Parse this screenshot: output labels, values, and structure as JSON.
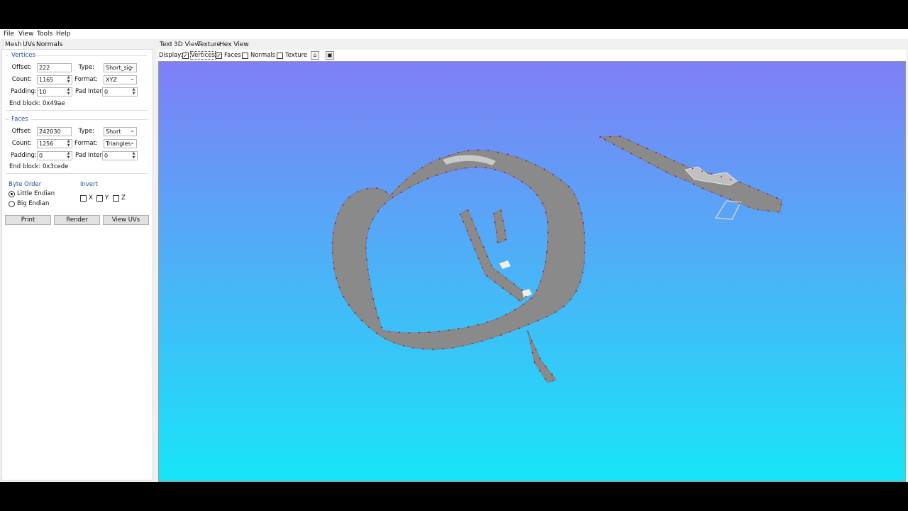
{
  "menu": [
    "File",
    "View",
    "Tools",
    "Help"
  ],
  "left_tabs": [
    "Mesh",
    "UVs",
    "Normals"
  ],
  "vertices": {
    "title": "Vertices",
    "offset_label": "Offset:",
    "offset": "222",
    "type_label": "Type:",
    "type": "Short_sig",
    "count_label": "Count:",
    "count": "1165",
    "format_label": "Format:",
    "format": "XYZ",
    "padding_label": "Padding:",
    "padding": "10",
    "pad_inter_label": "Pad Inter:",
    "pad_inter": "0",
    "end_block": "End block: 0x49ae"
  },
  "faces": {
    "title": "Faces",
    "offset_label": "Offset:",
    "offset": "242030",
    "type_label": "Type:",
    "type": "Short",
    "count_label": "Count:",
    "count": "1256",
    "format_label": "Format:",
    "format": "Triangles",
    "padding_label": "Padding:",
    "padding": "0",
    "pad_inter_label": "Pad Inter:",
    "pad_inter": "0",
    "end_block": "End block: 0x3cede"
  },
  "byte_order": {
    "title": "Byte Order",
    "little": "Little Endian",
    "big": "Big Endian",
    "selected": "little"
  },
  "invert": {
    "title": "Invert",
    "x": "X",
    "y": "Y",
    "z": "Z"
  },
  "buttons": {
    "print": "Print",
    "render": "Render",
    "view_uvs": "View UVs"
  },
  "right_tabs": [
    "Text",
    "3D View",
    "Texture",
    "Hex View"
  ],
  "display": {
    "label": "Display:",
    "vertices": "Vertices",
    "vertices_checked": true,
    "faces": "Faces",
    "faces_checked": true,
    "normals": "Normals",
    "normals_checked": false,
    "texture": "Texture",
    "texture_checked": false
  },
  "icons": {
    "home": "home-icon",
    "fit": "fit-view-icon"
  },
  "colors": {
    "viewport_top": "#7f7ff6",
    "viewport_bottom": "#16e6f8",
    "mesh": "#8a8a8a",
    "vertex": "#b0103a",
    "group_title": "#1f4e99"
  }
}
